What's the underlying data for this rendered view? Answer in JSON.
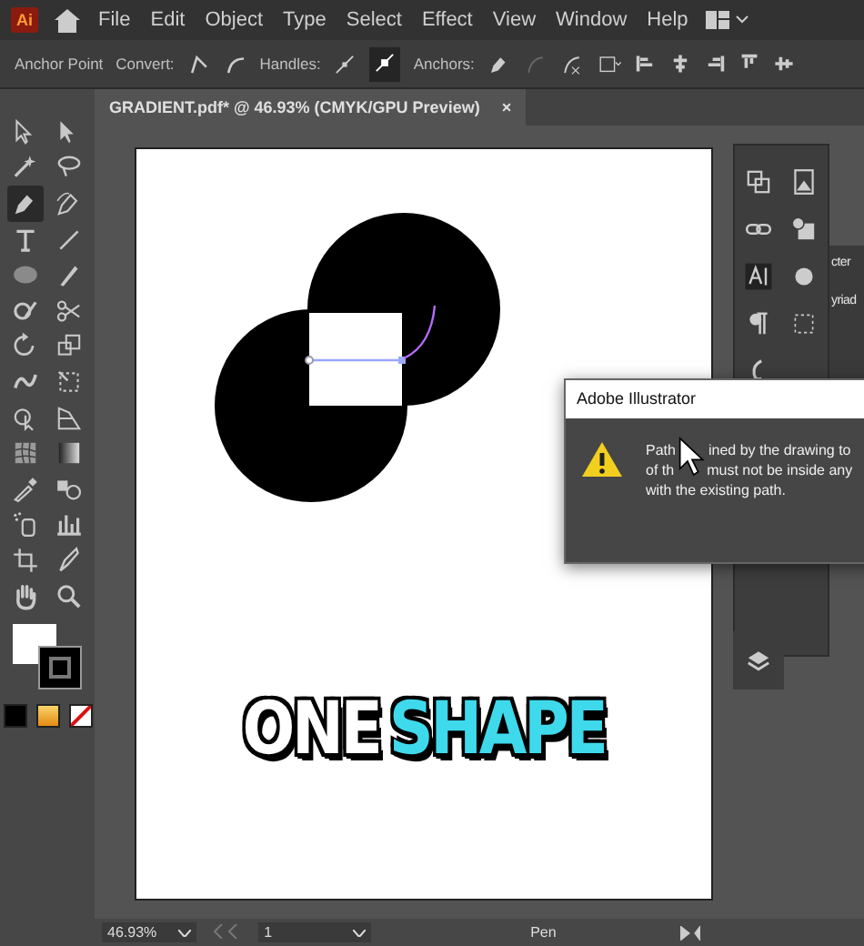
{
  "app": {
    "logo": "Ai"
  },
  "menu": [
    "File",
    "Edit",
    "Object",
    "Type",
    "Select",
    "Effect",
    "View",
    "Window",
    "Help"
  ],
  "control_bar": {
    "title": "Anchor Point",
    "convert": "Convert:",
    "handles": "Handles:",
    "anchors": "Anchors:"
  },
  "document_tab": {
    "title": "GRADIENT.pdf* @ 46.93% (CMYK/GPU Preview)",
    "close": "×"
  },
  "tools": [
    {
      "kind": "selection",
      "selected": false
    },
    {
      "kind": "direct",
      "selected": false
    },
    {
      "kind": "wand",
      "selected": false
    },
    {
      "kind": "lasso",
      "selected": false
    },
    {
      "kind": "pen",
      "selected": true
    },
    {
      "kind": "curvature",
      "selected": false
    },
    {
      "kind": "type",
      "selected": false
    },
    {
      "kind": "line",
      "selected": false
    },
    {
      "kind": "ellipse",
      "selected": false
    },
    {
      "kind": "brush",
      "selected": false
    },
    {
      "kind": "shaper",
      "selected": false
    },
    {
      "kind": "scissors",
      "selected": false
    },
    {
      "kind": "rotate",
      "selected": false
    },
    {
      "kind": "scale",
      "selected": false
    },
    {
      "kind": "warp",
      "selected": false
    },
    {
      "kind": "transform",
      "selected": false
    },
    {
      "kind": "builder",
      "selected": false
    },
    {
      "kind": "perspective",
      "selected": false
    },
    {
      "kind": "mesh",
      "selected": false
    },
    {
      "kind": "gradient",
      "selected": false
    },
    {
      "kind": "eyedropper",
      "selected": false
    },
    {
      "kind": "blend",
      "selected": false
    },
    {
      "kind": "sprayer",
      "selected": false
    },
    {
      "kind": "graph",
      "selected": false
    },
    {
      "kind": "artboard",
      "selected": false
    },
    {
      "kind": "slice",
      "selected": false
    },
    {
      "kind": "hand",
      "selected": false
    },
    {
      "kind": "zoom",
      "selected": false
    }
  ],
  "artboard": {
    "caption": [
      {
        "text": "ONE",
        "color": "#ffffff"
      },
      {
        "text": "SHAPE",
        "color": "#3fd9ec"
      }
    ]
  },
  "panel": {
    "partial_labels": [
      "cter",
      "yriad"
    ]
  },
  "dialog": {
    "title": "Adobe Illustrator",
    "lines": [
      [
        "Path",
        "ined by the drawing to"
      ],
      [
        "of th",
        "must not be inside any"
      ],
      [
        "with the existing path."
      ]
    ]
  },
  "status_bar": {
    "zoom": "46.93%",
    "page": "1",
    "tool": "Pen"
  }
}
